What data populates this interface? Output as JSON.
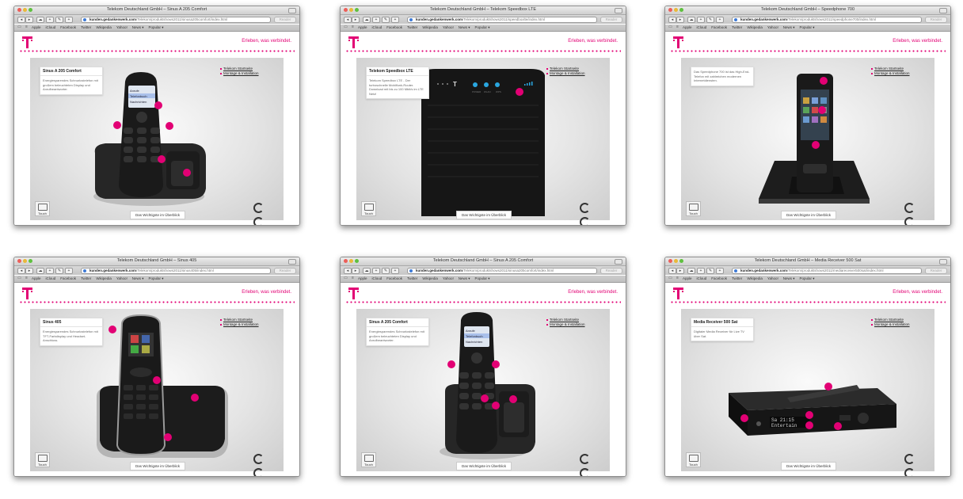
{
  "address_domain": "kunden.gedankenwerk.com",
  "slogan": "Erleben, was verbindet.",
  "reader_label": "Reader",
  "bookmarks": [
    "Apple",
    "iCloud",
    "Facebook",
    "Twitter",
    "Wikipedia",
    "Yahoo!",
    "News ▾",
    "Popular ▾"
  ],
  "links": [
    "Telekom Startseite",
    "Montage & Installation"
  ],
  "touch_label": "Touch",
  "overview_button": "Das Wichtigste im Überblick",
  "windows": [
    {
      "title": "Telekom Deutschland GmbH – Sinus A 205 Comfort",
      "url_path": "/Telekom/produktshows2011/sinusa205comfort/index.html",
      "product_title": "Sinus A 205 Comfort",
      "product_text": "Energiesparendes Schnurlostelefon mit großem beleuchteten Display und Anrufbeantworter.",
      "phone_screen_lines": [
        "Anrufe",
        "Telefonbuch",
        "Nachrichten"
      ]
    },
    {
      "title": "Telekom Deutschland GmbH – Telekom Speedbox LTE",
      "url_path": "/Telekom/produktshows2011/speedboxlte/index.html",
      "product_title": "Telekom Speedbox LTE",
      "product_text": "Telekom Speedbox LTE - Der turboschnelle Mobilfunk-Router. Download mit bis zu 100 Mbit/s im LTE Netz!",
      "status_labels": [
        "POWER",
        "WLAN",
        "WPS"
      ]
    },
    {
      "title": "Telekom Deutschland GmbH – Speedphone 700",
      "url_path": "/Telekom/produktshows2011/speedphone700/index.html",
      "product_title": "",
      "product_text": "Das Speedphone 700 ist das High-End-Telefon mit zahlreichen modernen Internetdiensten."
    },
    {
      "title": "Telekom Deutschland GmbH – Sinus 405",
      "url_path": "/Telekom/produktshows2011/sinus405/index.html",
      "product_title": "Sinus 405",
      "product_text": "Energiesparendes Schnurlostelefon mit TFT-Farbdisplay und Headset-Anschluss."
    },
    {
      "title": "Telekom Deutschland GmbH – Sinus A 205 Comfort",
      "url_path": "/Telekom/produktshows2011/sinusa205comfort/index.html",
      "product_title": "Sinus A 205 Comfort",
      "product_text": "Energiesparendes Schnurlostelefon mit großem beleuchteten Display und Anrufbeantworter.",
      "phone_screen_lines": [
        "Anrufe",
        "Telefonbuch",
        "Nachrichten"
      ]
    },
    {
      "title": "Telekom Deutschland GmbH – Media Receiver 500 Sat",
      "url_path": "/Telekom/produktshows2011/mediareceiver500sat/index.html",
      "product_title": "Media Receiver 500 Sat",
      "product_text": "Digitaler Media Receiver für Live TV über Sat.",
      "display_line1": "Sa  21:15",
      "display_line2": "Entertain"
    }
  ],
  "colors": {
    "accent": "#e20074",
    "device": "#1e1e1e",
    "stage": "#dcdcdc"
  }
}
